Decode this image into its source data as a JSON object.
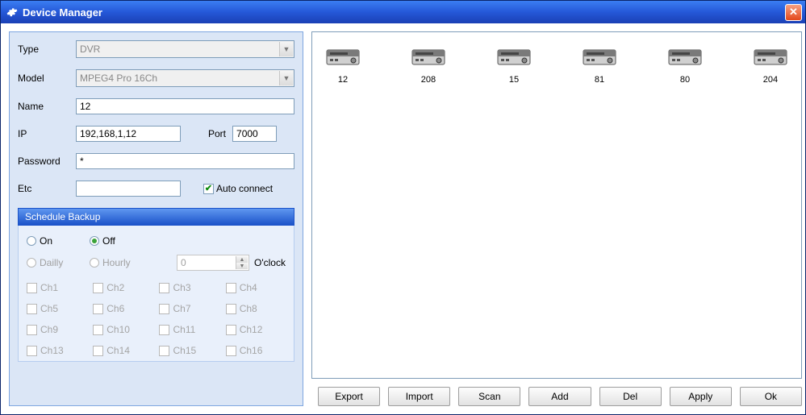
{
  "window": {
    "title": "Device Manager"
  },
  "form": {
    "type_label": "Type",
    "type_value": "DVR",
    "model_label": "Model",
    "model_value": "MPEG4 Pro 16Ch",
    "name_label": "Name",
    "name_value": "12",
    "ip_label": "IP",
    "ip_value": "192,168,1,12",
    "port_label": "Port",
    "port_value": "7000",
    "password_label": "Password",
    "password_value": "*",
    "etc_label": "Etc",
    "etc_value": "",
    "autoconnect_label": "Auto connect",
    "autoconnect_checked": true
  },
  "schedule": {
    "header": "Schedule Backup",
    "on_label": "On",
    "off_label": "Off",
    "off_selected": true,
    "daily_label": "Dailly",
    "hourly_label": "Hourly",
    "hour_value": "0",
    "oclock_label": "O'clock",
    "channels": [
      "Ch1",
      "Ch2",
      "Ch3",
      "Ch4",
      "Ch5",
      "Ch6",
      "Ch7",
      "Ch8",
      "Ch9",
      "Ch10",
      "Ch11",
      "Ch12",
      "Ch13",
      "Ch14",
      "Ch15",
      "Ch16"
    ]
  },
  "devices": [
    {
      "name": "12"
    },
    {
      "name": "208"
    },
    {
      "name": "15"
    },
    {
      "name": "81"
    },
    {
      "name": "80"
    },
    {
      "name": "204"
    }
  ],
  "buttons": {
    "export": "Export",
    "import": "Import",
    "scan": "Scan",
    "add": "Add",
    "del": "Del",
    "apply": "Apply",
    "ok": "Ok"
  }
}
